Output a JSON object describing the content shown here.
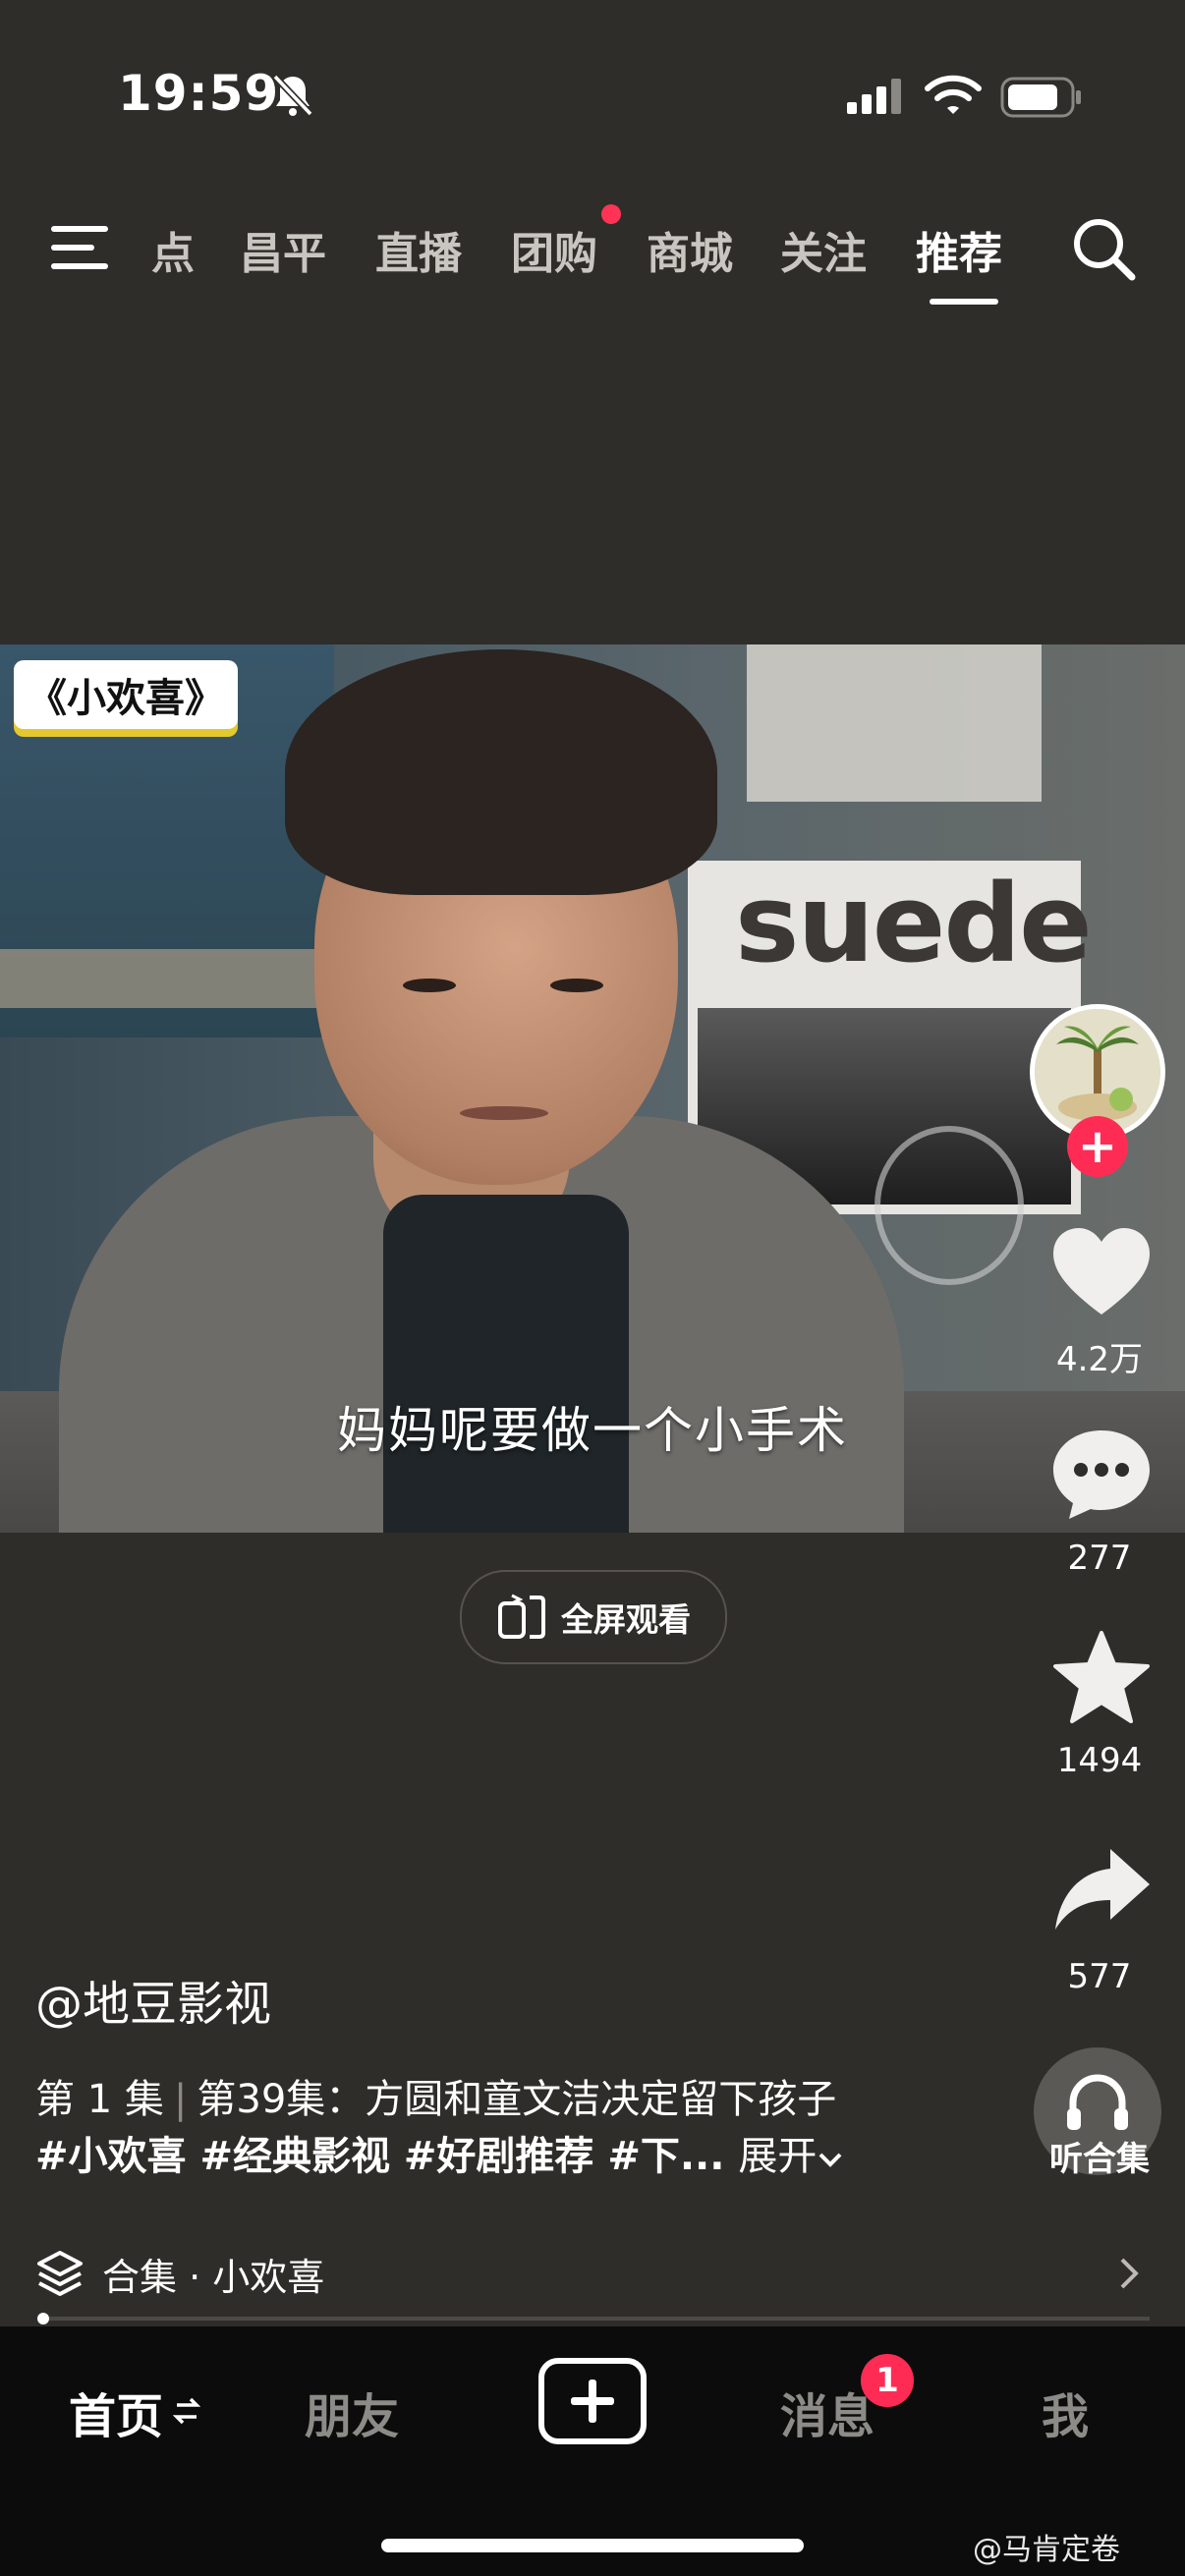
{
  "status_bar": {
    "time": "19:59"
  },
  "top_tabs": [
    {
      "label": "点"
    },
    {
      "label": "昌平"
    },
    {
      "label": "直播"
    },
    {
      "label": "团购"
    },
    {
      "label": "商城"
    },
    {
      "label": "关注"
    },
    {
      "label": "推荐"
    }
  ],
  "video": {
    "show_logo": "《小欢喜》",
    "poster_text": "suede",
    "subtitle": "妈妈呢要做一个小手术",
    "fullscreen_label": "全屏观看"
  },
  "actions": {
    "likes": "4.2万",
    "comments": "277",
    "favorites": "1494",
    "shares": "577",
    "audio_label": "听合集"
  },
  "caption": {
    "author": "@地豆影视",
    "episode": "第 1 集",
    "episode_title": "第39集：方圆和童文洁决定留下孩子",
    "hashtags": "#小欢喜 #经典影视 #好剧推荐 #下...",
    "expand": "展开"
  },
  "collection": {
    "label": "合集 · 小欢喜"
  },
  "bottom_nav": {
    "home": "首页",
    "friends": "朋友",
    "messages": "消息",
    "messages_badge": "1",
    "me": "我"
  },
  "watermark": "@马肯定卷",
  "colors": {
    "accent": "#fe2c55",
    "background": "#2f2d2a",
    "nav_background": "#0c0c0c"
  }
}
